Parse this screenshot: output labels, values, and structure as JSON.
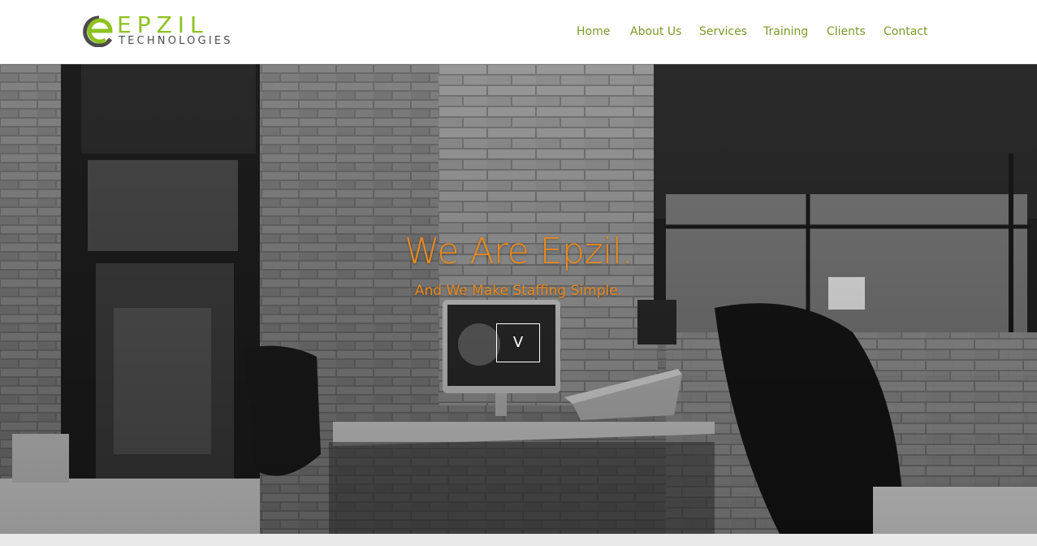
{
  "brand": {
    "word": "EPZIL",
    "sub": "TECHNOLOGIES",
    "accent_color": "#8dc21f",
    "mark_color": "#4d4d4d"
  },
  "nav": {
    "items": [
      {
        "label": "Home"
      },
      {
        "label": "About Us"
      },
      {
        "label": "Services"
      },
      {
        "label": "Training"
      },
      {
        "label": "Clients"
      },
      {
        "label": "Contact"
      }
    ],
    "color": "#7a9a2a"
  },
  "hero": {
    "title": "We Are Epzil.",
    "subtitle": "And We Make Staffing Simple.",
    "scroll_label": "V",
    "text_color": "#ea8a1c",
    "background_icon": "office-photo"
  }
}
